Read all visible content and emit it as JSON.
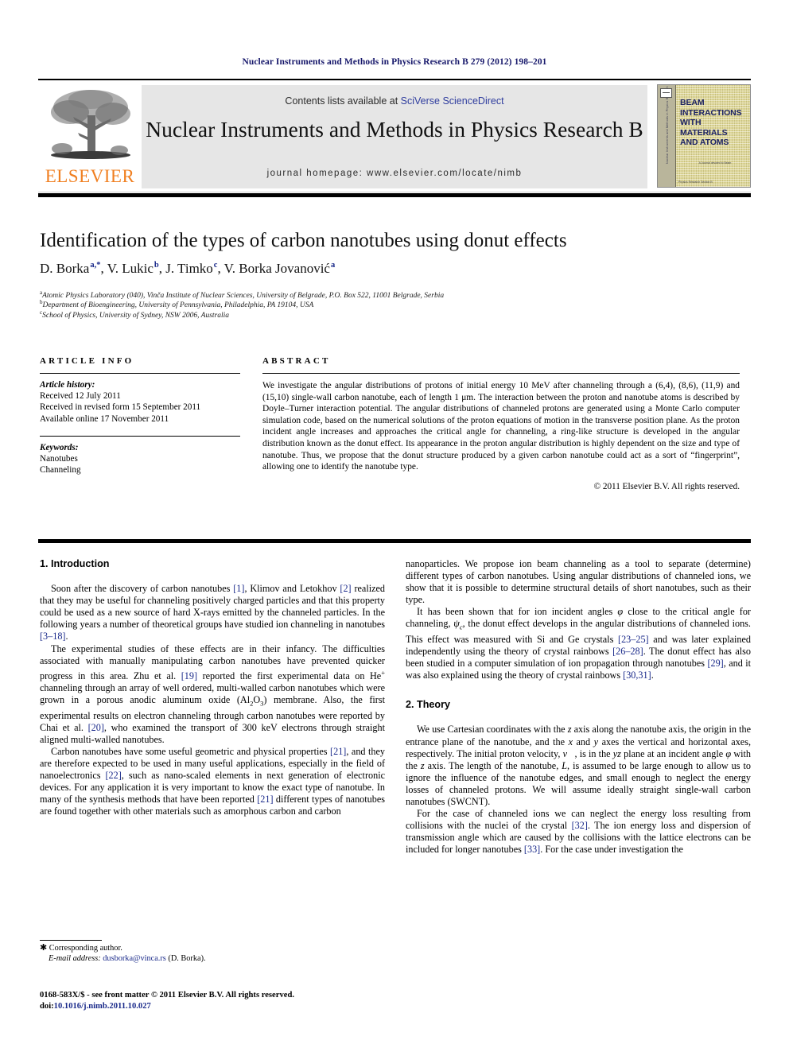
{
  "running_head": "Nuclear Instruments and Methods in Physics Research B 279 (2012) 198–201",
  "masthead": {
    "contents_prefix": "Contents lists available at ",
    "contents_link": "SciVerse ScienceDirect",
    "journal_title": "Nuclear Instruments and Methods in Physics Research B",
    "homepage": "journal homepage: www.elsevier.com/locate/nimb",
    "publisher_wordmark": "ELSEVIER",
    "cover": {
      "title": "BEAM INTERACTIONS WITH MATERIALS AND ATOMS",
      "spine_text": "Nuclear Instruments and Methods in Physics Research B",
      "mid_text": "A Journal devoted to Beam",
      "foot_text": "Physics Research Section B"
    },
    "accent_orange": "#f07f20",
    "accent_blue": "#2f3d9e",
    "panel_gray": "#e6e6e6"
  },
  "article": {
    "title": "Identification of the types of carbon nanotubes using donut effects",
    "authors": [
      {
        "name": "D. Borka",
        "marks": "a,*"
      },
      {
        "name": "V. Lukic",
        "marks": "b"
      },
      {
        "name": "J. Timko",
        "marks": "c"
      },
      {
        "name": "V. Borka Jovanović",
        "marks": "a"
      }
    ],
    "affiliations": [
      {
        "mark": "a",
        "text": "Atomic Physics Laboratory (040), Vinča Institute of Nuclear Sciences, University of Belgrade, P.O. Box 522, 11001 Belgrade, Serbia"
      },
      {
        "mark": "b",
        "text": "Department of Bioengineering, University of Pennsylvania, Philadelphia, PA 19104, USA"
      },
      {
        "mark": "c",
        "text": "School of Physics, University of Sydney, NSW 2006, Australia"
      }
    ]
  },
  "article_info": {
    "heading": "ARTICLE INFO",
    "history_label": "Article history:",
    "history": [
      "Received 12 July 2011",
      "Received in revised form 15 September 2011",
      "Available online 17 November 2011"
    ],
    "keywords_label": "Keywords:",
    "keywords": [
      "Nanotubes",
      "Channeling"
    ]
  },
  "abstract": {
    "heading": "ABSTRACT",
    "text": "We investigate the angular distributions of protons of initial energy 10 MeV after channeling through a (6,4), (8,6), (11,9) and (15,10) single-wall carbon nanotube, each of length 1 μm. The interaction between the proton and nanotube atoms is described by Doyle–Turner interaction potential. The angular distributions of channeled protons are generated using a Monte Carlo computer simulation code, based on the numerical solutions of the proton equations of motion in the transverse position plane. As the proton incident angle increases and approaches the critical angle for channeling, a ring-like structure is developed in the angular distribution known as the donut effect. Its appearance in the proton angular distribution is highly dependent on the size and type of nanotube. Thus, we propose that the donut structure produced by a given carbon nanotube could act as a sort of “fingerprint”, allowing one to identify the nanotube type.",
    "copyright": "© 2011 Elsevier B.V. All rights reserved."
  },
  "body": {
    "section1_heading": "1. Introduction",
    "section2_heading": "2. Theory",
    "left_paragraphs": [
      "Soon after the discovery of carbon nanotubes [1], Klimov and Letokhov [2] realized that they may be useful for channeling positively charged particles and that this property could be used as a new source of hard X-rays emitted by the channeled particles. In the following years a number of theoretical groups have studied ion channeling in nanotubes [3–18].",
      "The experimental studies of these effects are in their infancy. The difficulties associated with manually manipulating carbon nanotubes have prevented quicker progress in this area. Zhu et al. [19] reported the first experimental data on He+ channeling through an array of well ordered, multi-walled carbon nanotubes which were grown in a porous anodic aluminum oxide (Al2O3) membrane. Also, the first experimental results on electron channeling through carbon nanotubes were reported by Chai et al. [20], who examined the transport of 300 keV electrons through straight aligned multi-walled nanotubes.",
      "Carbon nanotubes have some useful geometric and physical properties [21], and they are therefore expected to be used in many useful applications, especially in the field of nanoelectronics [22], such as nano-scaled elements in next generation of electronic devices. For any application it is very important to know the exact type of nanotube. In many of the synthesis methods that have been reported [21] different types of nanotubes are found together with other materials such as amorphous carbon and carbon"
    ],
    "right_paragraphs": [
      "nanoparticles. We propose ion beam channeling as a tool to separate (determine) different types of carbon nanotubes. Using angular distributions of channeled ions, we show that it is possible to determine structural details of short nanotubes, such as their type.",
      "It has been shown that for ion incident angles φ close to the critical angle for channeling, ψc, the donut effect develops in the angular distributions of channeled ions. This effect was measured with Si and Ge crystals [23–25] and was later explained independently using the theory of crystal rainbows [26–28]. The donut effect has also been studied in a computer simulation of ion propagation through nanotubes [29], and it was also explained using the theory of crystal rainbows [30,31].",
      "We use Cartesian coordinates with the z axis along the nanotube axis, the origin in the entrance plane of the nanotube, and the x and y axes the vertical and horizontal axes, respectively. The initial proton velocity, v⃗, is in the yz plane at an incident angle φ with the z axis. The length of the nanotube, L, is assumed to be large enough to allow us to ignore the influence of the nanotube edges, and small enough to neglect the energy losses of channeled protons. We will assume ideally straight single-wall carbon nanotubes (SWCNT).",
      "For the case of channeled ions we can neglect the energy loss resulting from collisions with the nuclei of the crystal [32]. The ion energy loss and dispersion of transmission angle which are caused by the collisions with the lattice electrons can be included for longer nanotubes [33]. For the case under investigation the"
    ]
  },
  "footnote": {
    "corresponding": "Corresponding author.",
    "email_label": "E-mail address:",
    "email": "dusborka@vinca.rs",
    "email_suffix": "(D. Borka)."
  },
  "footer": {
    "issn_line": "0168-583X/$ - see front matter © 2011 Elsevier B.V. All rights reserved.",
    "doi_label": "doi:",
    "doi": "10.1016/j.nimb.2011.10.027"
  }
}
